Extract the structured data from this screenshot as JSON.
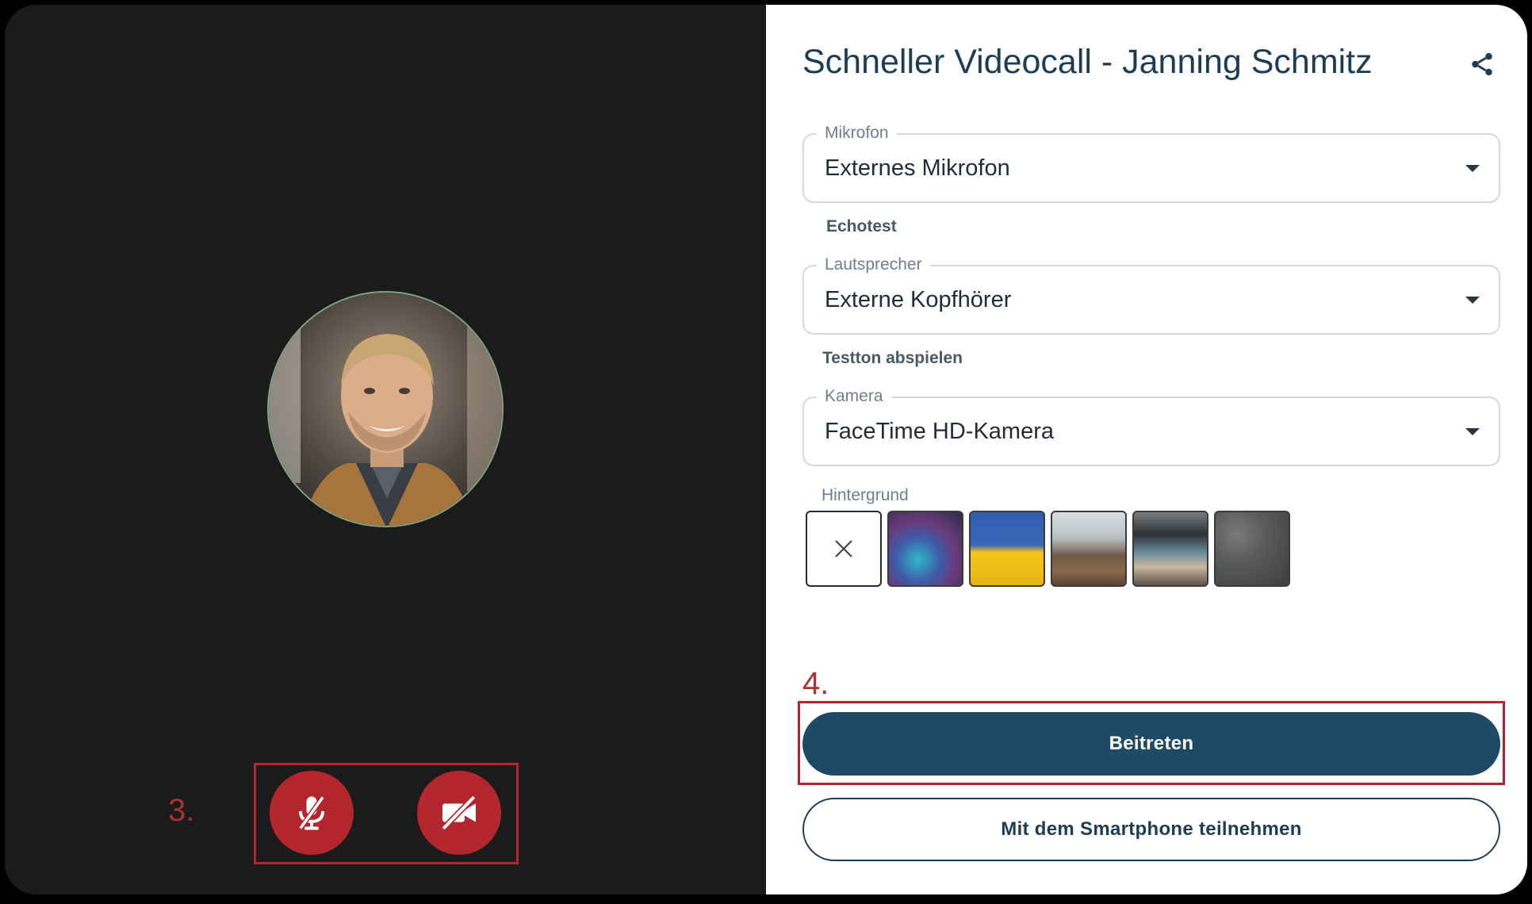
{
  "title": "Schneller Videocall - Janning Schmitz",
  "fields": {
    "microphone": {
      "label": "Mikrofon",
      "value": "Externes Mikrofon",
      "link": "Echotest"
    },
    "speaker": {
      "label": "Lautsprecher",
      "value": "Externe Kopfhörer",
      "link": "Testton abspielen"
    },
    "camera": {
      "label": "Kamera",
      "value": "FaceTime HD-Kamera"
    }
  },
  "background": {
    "label": "Hintergrund",
    "options": [
      "none",
      "blue-purple-blur",
      "blue-yellow-flag",
      "living-room",
      "office-lounge",
      "grey-texture"
    ]
  },
  "buttons": {
    "join": "Beitreten",
    "smartphone": "Mit dem Smartphone teilnehmen"
  },
  "annotations": {
    "step3": "3.",
    "step4": "4."
  },
  "icons": {
    "share": "share-icon",
    "mic_off": "microphone-off-icon",
    "camera_off": "camera-off-icon",
    "close": "close-icon"
  },
  "colors": {
    "primary": "#1f4a66",
    "danger": "#b3262d",
    "title": "#1d3d55",
    "left_background": "#1b1b1b"
  }
}
